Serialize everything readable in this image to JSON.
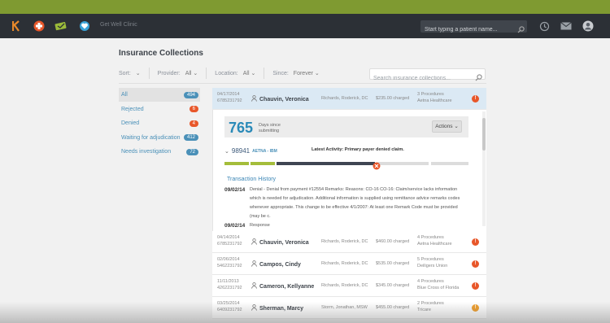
{
  "nav": {
    "app_name": "Get Well Clinic",
    "patient_search_placeholder": "Start typing a patient name..."
  },
  "page": {
    "title": "Insurance Collections"
  },
  "filters": {
    "sort_label": "Sort:",
    "provider_label": "Provider:",
    "provider_value": "All",
    "location_label": "Location:",
    "location_value": "All",
    "since_label": "Since:",
    "since_value": "Forever",
    "search_placeholder": "Search insurance collections..."
  },
  "sidebar": {
    "items": [
      {
        "label": "All",
        "count": "494",
        "color": "#4a90b8"
      },
      {
        "label": "Rejected",
        "count": "6",
        "color": "#e8572a"
      },
      {
        "label": "Denied",
        "count": "4",
        "color": "#e8572a"
      },
      {
        "label": "Waiting for adjudication",
        "count": "412",
        "color": "#4a90b8"
      },
      {
        "label": "Needs investigation",
        "count": "72",
        "color": "#4a90b8"
      }
    ]
  },
  "selected_row": {
    "date": "04/17/2014",
    "id": "6785231792",
    "name": "Chauvin, Veronica",
    "provider": "Richards, Roderick, DC",
    "amount": "$235.00 charged",
    "procedures": "3 Procedures",
    "payer": "Aetna Healthcare"
  },
  "detail": {
    "days": "765",
    "days_label": "Days since submitting",
    "actions_label": "Actions",
    "claim_number": "98941",
    "claim_payer": "AETNA - IBM",
    "latest_activity": "Latest Activity: Primary payer denied claim.",
    "history_title": "Transaction History",
    "history": [
      {
        "date": "09/02/14",
        "text": "Denial - Denial from payment #12554 Remarks: Reasons: CO-16 CO-16: Claim/service lacks information which is needed for adjudication. Additional information is supplied using remittance advice remarks codes whenever appropriate. This change to be effective 4/1/2007: At least one Remark Code must be provided (may be c."
      },
      {
        "date": "09/02/14",
        "text": "Response"
      }
    ]
  },
  "rows": [
    {
      "date": "04/14/2014",
      "id": "6785231792",
      "name": "Chauvin, Veronica",
      "provider": "Richards, Roderick, DC",
      "amount": "$460.00 charged",
      "procedures": "4 Procedures",
      "payer": "Aetna Healthcare",
      "alert_color": "#e8572a"
    },
    {
      "date": "02/06/2014",
      "id": "5462231792",
      "name": "Campos, Cindy",
      "provider": "Richards, Roderick, DC",
      "amount": "$535.00 charged",
      "procedures": "5 Procedures",
      "payer": "Deiligers Union",
      "alert_color": "#e8572a"
    },
    {
      "date": "11/11/2013",
      "id": "4262231792",
      "name": "Cameron, Kellyanne",
      "provider": "Richards, Roderick, DC",
      "amount": "$345.00 charged",
      "procedures": "4 Procedures",
      "payer": "Blue Cross of Florida",
      "alert_color": "#e8572a"
    },
    {
      "date": "03/25/2014",
      "id": "6409231792",
      "name": "Sherman, Marcy",
      "provider": "Storm, Jonathan, MSW",
      "amount": "$455.00 charged",
      "procedures": "2 Procedures",
      "payer": "Tricare",
      "alert_color": "#f0a030"
    }
  ],
  "icons": {
    "alert": "!"
  }
}
